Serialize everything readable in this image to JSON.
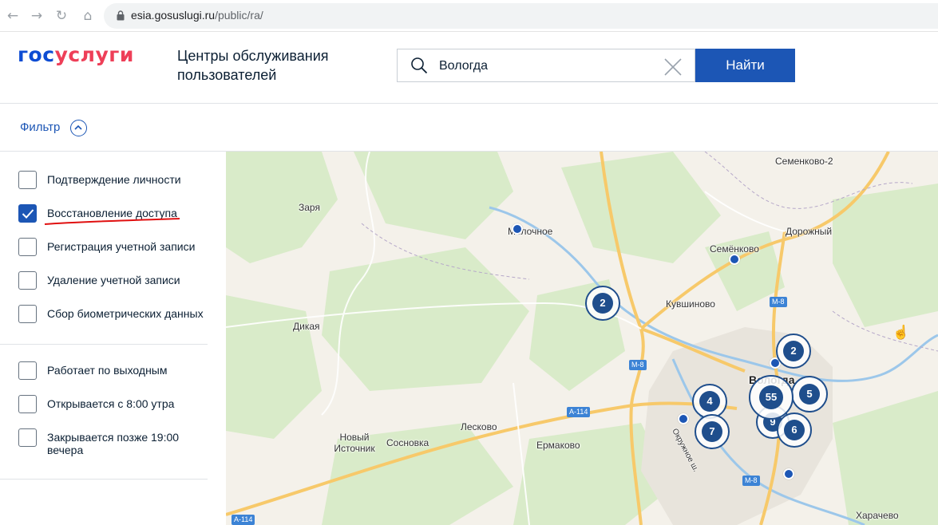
{
  "browser": {
    "url_host": "esia.gosuslugi.ru",
    "url_path": "/public/ra/"
  },
  "header": {
    "logo_part1": "гос",
    "logo_part2": "услуги",
    "title": "Центры обслуживания пользователей",
    "search_value": "Вологда",
    "search_button": "Найти"
  },
  "filter": {
    "label": "Фильтр"
  },
  "sidebar": {
    "services": [
      {
        "label": "Подтверждение личности",
        "checked": false
      },
      {
        "label": "Восстановление доступа",
        "checked": true
      },
      {
        "label": "Регистрация учетной записи",
        "checked": false
      },
      {
        "label": "Удаление учетной записи",
        "checked": false
      },
      {
        "label": "Сбор биометрических данных",
        "checked": false
      }
    ],
    "hours": [
      {
        "label": "Работает по выходным",
        "checked": false
      },
      {
        "label": "Открывается с 8:00 утра",
        "checked": false
      },
      {
        "label": "Закрывается позже 19:00 вечера",
        "checked": false
      }
    ]
  },
  "map": {
    "places": [
      "Семенково-2",
      "Заря",
      "Молочное",
      "Дорожный",
      "Семёнково",
      "Кувшиново",
      "Дикая",
      "Вологда",
      "Новый Источник",
      "Сосновка",
      "Лесково",
      "Ермаково",
      "Харачево",
      "Окружное ш."
    ],
    "roads": [
      "М-8",
      "М-8",
      "М-8",
      "А-114",
      "А-114"
    ],
    "clusters": [
      2,
      2,
      4,
      55,
      5,
      7,
      9,
      6
    ]
  },
  "colors": {
    "primary": "#1c56b5",
    "logo_blue": "#0d4cd3",
    "logo_red": "#ee3f58",
    "cluster": "#1f4e8c"
  }
}
